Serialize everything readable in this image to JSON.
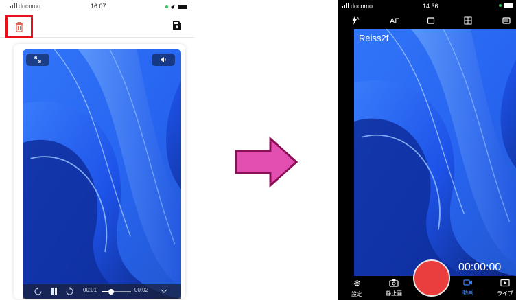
{
  "left_phone": {
    "status": {
      "carrier": "docomo",
      "time": "16:07"
    },
    "controls": {
      "current_time": "00:01",
      "end_time": "00:02",
      "progress": 0.3
    }
  },
  "right_phone": {
    "status": {
      "carrier": "docomo",
      "time": "14:36"
    },
    "topbar": {
      "af_label": "AF"
    },
    "channel_label": "Reiss2f",
    "timer": "00:00:00",
    "nav": [
      {
        "label": "設定",
        "icon": "gear-icon"
      },
      {
        "label": "静止画",
        "icon": "camera-icon"
      },
      {
        "label": "動画",
        "icon": "video-camera-icon",
        "active": true
      },
      {
        "label": "ライブ",
        "icon": "live-icon"
      }
    ]
  },
  "colors": {
    "highlight_box": "#e8101c",
    "arrow_fill": "#e34fb0",
    "arrow_stroke": "#8c1056",
    "record_button": "#ea3d3d",
    "active_nav": "#3b82f6"
  }
}
